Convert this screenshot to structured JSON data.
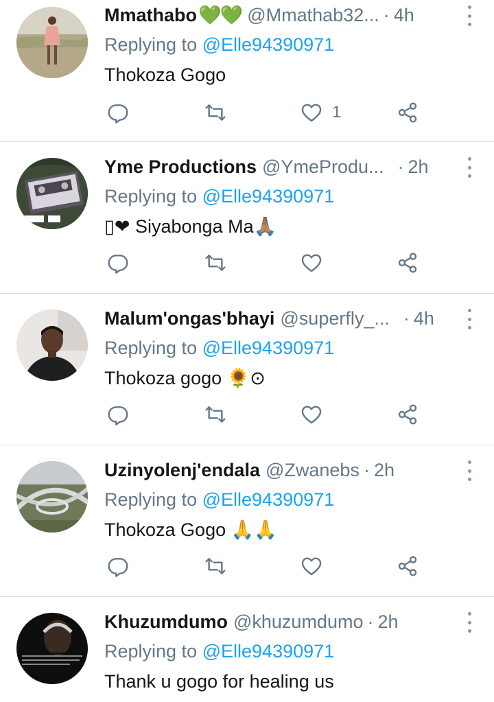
{
  "tweets": [
    {
      "name": "Mmathabo",
      "name_emoji": "💚💚",
      "handle": "@Mmathab32...",
      "separator": "·",
      "time": "4h",
      "replying_prefix": "Replying to",
      "replying_handle": "@Elle94390971",
      "text": "Thokoza Gogo",
      "like_count": "1",
      "avatar": "photo-person-standing-field"
    },
    {
      "name": "Yme Productions",
      "name_emoji": "",
      "handle": "@YmeProdu...",
      "separator": "·",
      "time": "2h",
      "replying_prefix": "Replying to",
      "replying_handle": "@Elle94390971",
      "text": "▯❤ Siyabonga Ma🙏🏽",
      "like_count": "",
      "avatar": "photo-cassette-tape-cover"
    },
    {
      "name": "Malum'ongas'bhayi",
      "name_emoji": "",
      "handle": "@superfly_...",
      "separator": "·",
      "time": "4h",
      "replying_prefix": "Replying to",
      "replying_handle": "@Elle94390971",
      "text": "Thokoza gogo 🌻⊙",
      "like_count": "",
      "avatar": "photo-man-portrait"
    },
    {
      "name": "Uzinyolenj'endala",
      "name_emoji": "",
      "handle": "@Zwanebs",
      "separator": "·",
      "time": "2h",
      "replying_prefix": "Replying to",
      "replying_handle": "@Elle94390971",
      "text": "Thokoza Gogo 🙏🙏",
      "like_count": "",
      "avatar": "photo-highway-interchange"
    },
    {
      "name": "Khuzumdumo",
      "name_emoji": "",
      "handle": "@khuzumdumo",
      "separator": "·",
      "time": "2h",
      "replying_prefix": "Replying to",
      "replying_handle": "@Elle94390971",
      "text": "Thank u gogo for healing us",
      "like_count": "",
      "avatar": "photo-man-quote-poster",
      "avatar_quote": "stupid is knowing the truth, seeing the truth, but still believing the lies."
    }
  ],
  "icons": {
    "reply": "reply-icon",
    "retweet": "retweet-icon",
    "like": "heart-icon",
    "share": "share-icon",
    "more": "more-vertical-icon"
  },
  "colors": {
    "link": "#1da1f2",
    "secondary": "#657786",
    "icon": "#657786",
    "divider": "#d9dee2"
  }
}
